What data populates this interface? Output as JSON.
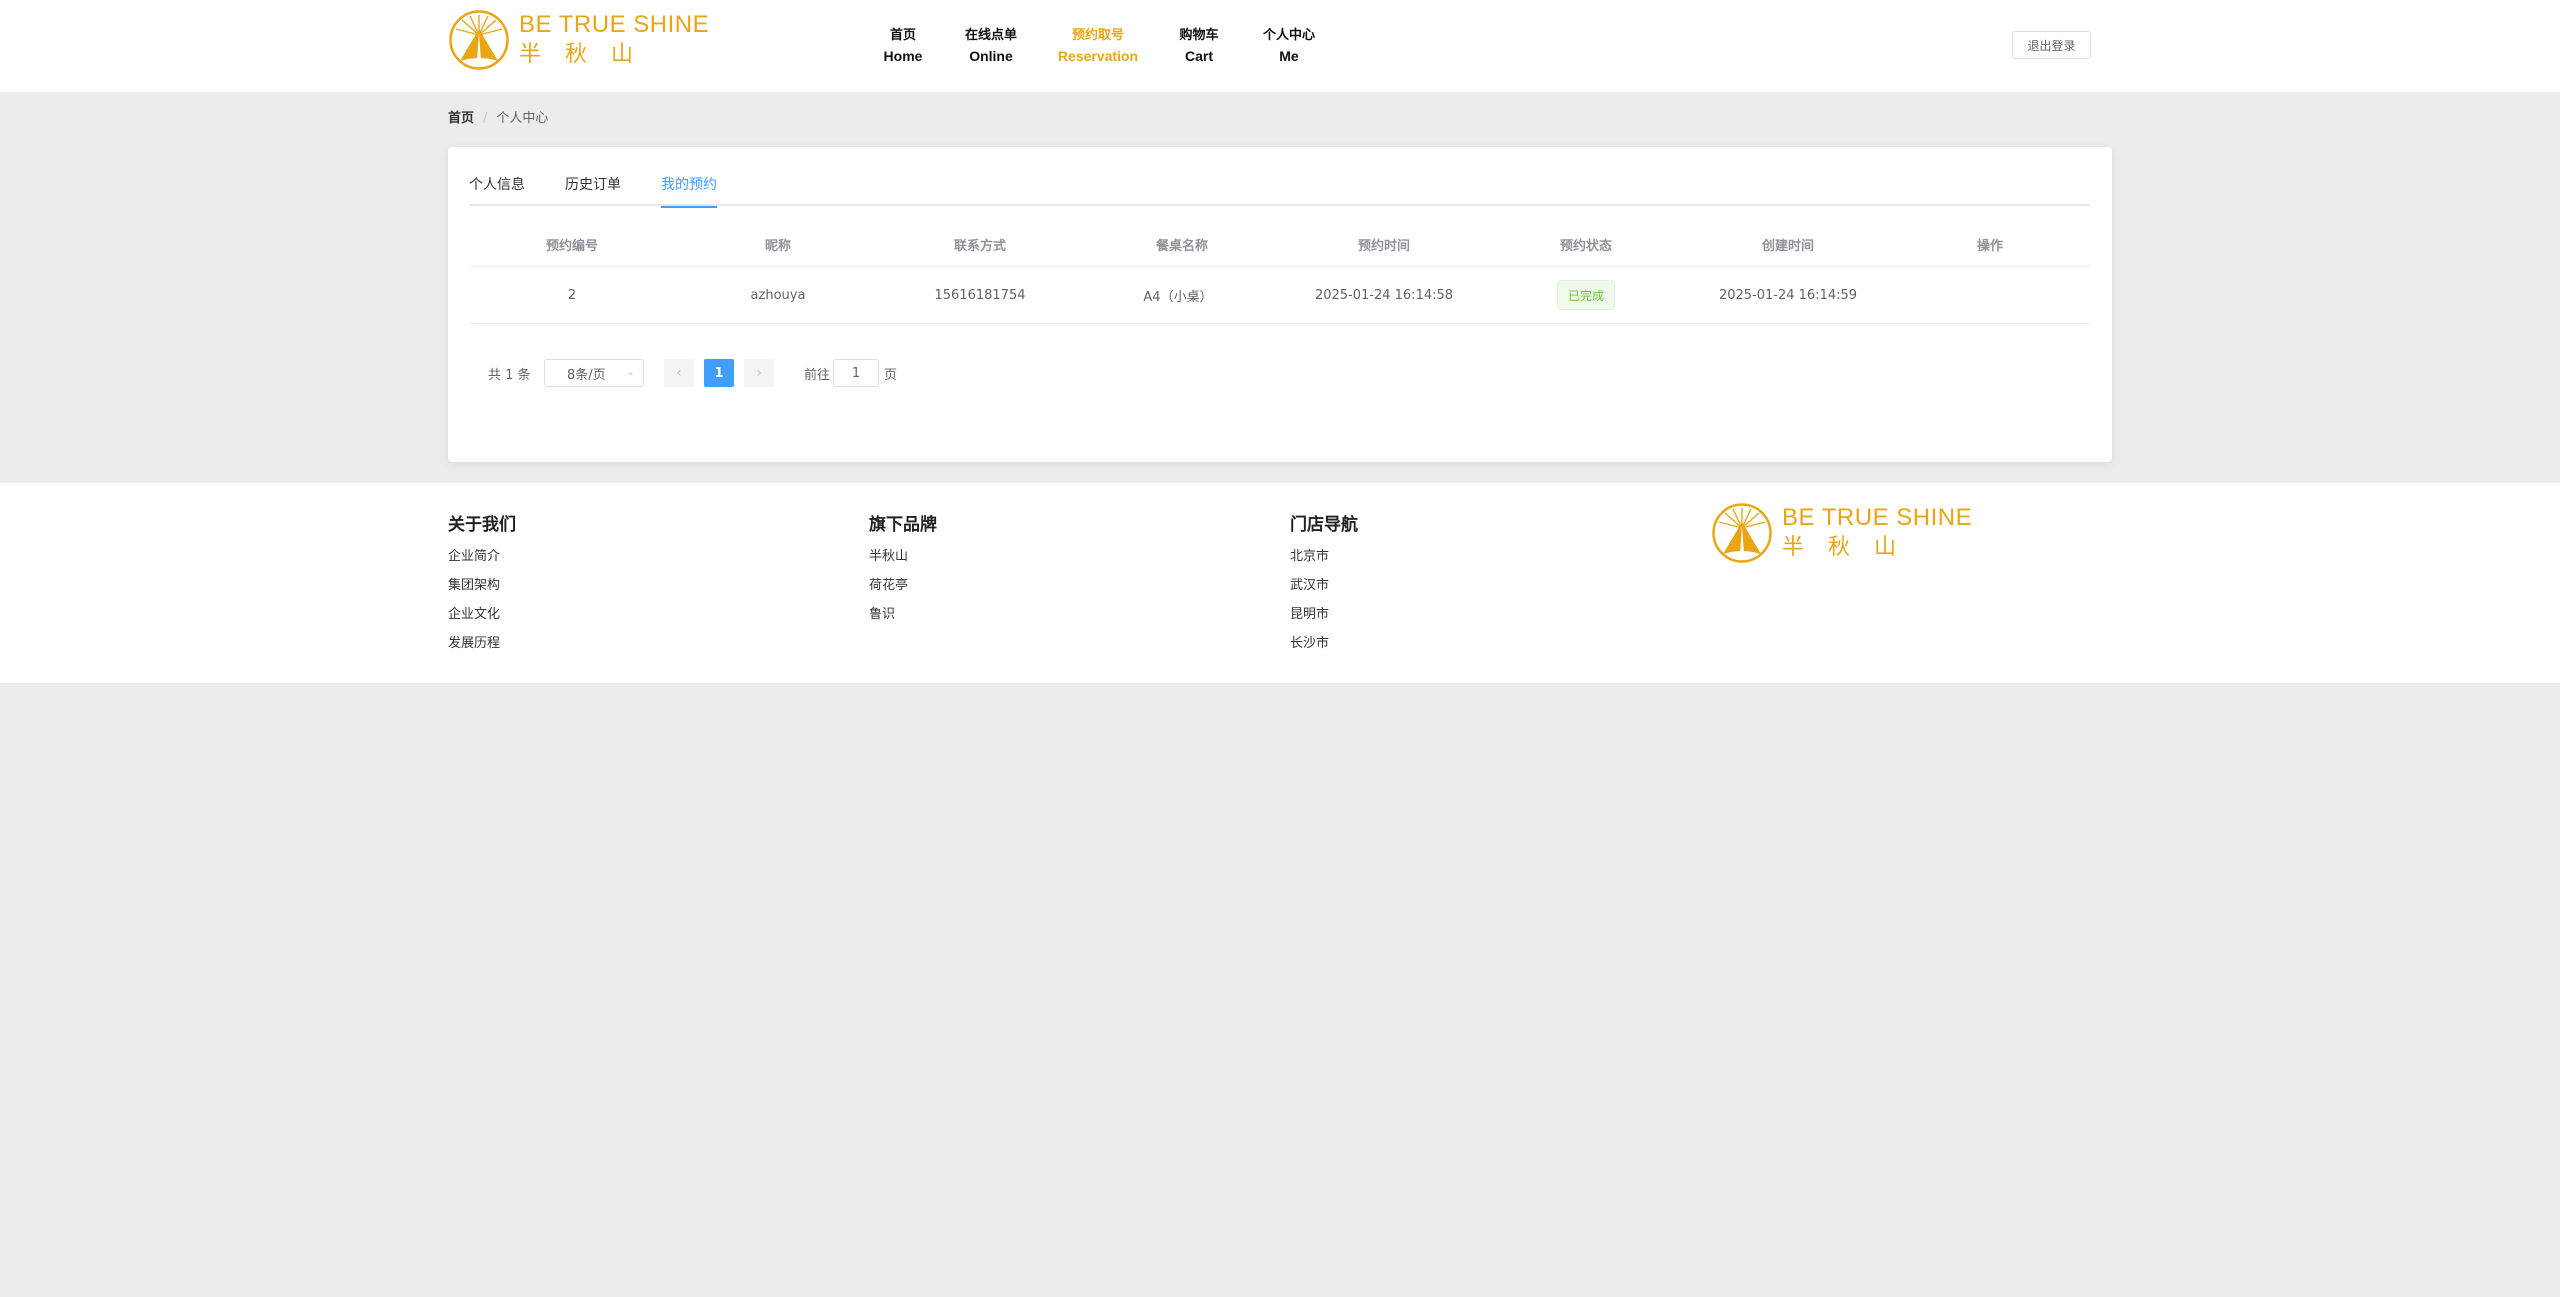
{
  "brand": {
    "name_en": "BE TRUE SHINE",
    "name_cn": "半秋山",
    "color": "#e9a614"
  },
  "nav": [
    {
      "cn": "首页",
      "en": "Home"
    },
    {
      "cn": "在线点单",
      "en": "Online"
    },
    {
      "cn": "预约取号",
      "en": "Reservation"
    },
    {
      "cn": "购物车",
      "en": "Cart"
    },
    {
      "cn": "个人中心",
      "en": "Me"
    }
  ],
  "logout_label": "退出登录",
  "breadcrumb": {
    "home": "首页",
    "separator": "/",
    "current": "个人中心"
  },
  "tabs": [
    {
      "label": "个人信息"
    },
    {
      "label": "历史订单"
    },
    {
      "label": "我的预约",
      "active": true
    }
  ],
  "table": {
    "columns": [
      "预约编号",
      "昵称",
      "联系方式",
      "餐桌名称",
      "预约时间",
      "预约状态",
      "创建时间",
      "操作"
    ],
    "rows": [
      {
        "id": "2",
        "nickname": "azhouya",
        "phone": "15616181754",
        "table_name": "A4（小桌）",
        "reserve_time": "2025-01-24 16:14:58",
        "status": "已完成",
        "created_time": "2025-01-24 16:14:59",
        "action": ""
      }
    ]
  },
  "pagination": {
    "total_text": "共 1 条",
    "page_size": "8条/页",
    "current_page": "1",
    "goto_label": "前往",
    "goto_value": "1",
    "goto_unit": "页"
  },
  "footer": {
    "columns": [
      {
        "title": "关于我们",
        "links": [
          "企业简介",
          "集团架构",
          "企业文化",
          "发展历程"
        ]
      },
      {
        "title": "旗下品牌",
        "links": [
          "半秋山",
          "荷花亭",
          "鲁识"
        ]
      },
      {
        "title": "门店导航",
        "links": [
          "北京市",
          "武汉市",
          "昆明市",
          "长沙市"
        ]
      }
    ]
  }
}
